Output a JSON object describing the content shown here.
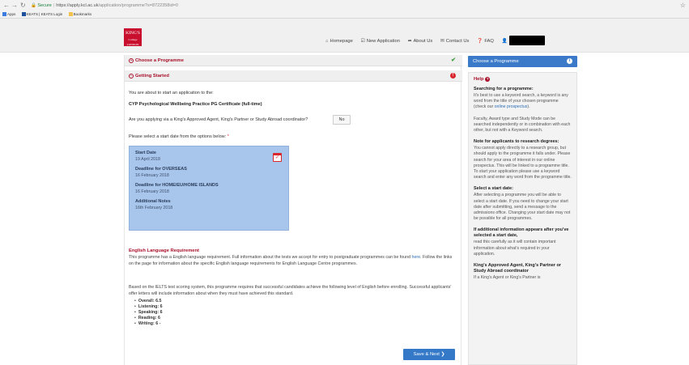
{
  "browser": {
    "secure_label": "Secure",
    "url_host": "https://apply.kcl.ac.uk",
    "url_path": "/application/programme?s=8722358id=0",
    "bookmarks": [
      {
        "label": "Apps",
        "color": "#3d7be0"
      },
      {
        "label": "KEATS | KEATS Login",
        "color": "#1f4e9c"
      },
      {
        "label": "Bookmarks",
        "color": "#f2c14e"
      }
    ]
  },
  "header": {
    "logo_line1": "KING'S",
    "logo_line2": "College LONDON",
    "nav": [
      {
        "icon": "home-icon",
        "glyph": "⌂",
        "label": "Homepage"
      },
      {
        "icon": "new-application-icon",
        "glyph": "☑",
        "label": "New Application"
      },
      {
        "icon": "about-icon",
        "glyph": "➦",
        "label": "About Us"
      },
      {
        "icon": "envelope-icon",
        "glyph": "✉",
        "label": "Contact Us"
      },
      {
        "icon": "question-icon",
        "glyph": "❓",
        "label": "FAQ"
      }
    ]
  },
  "main": {
    "section1": "Choose a Programme",
    "section2": "Getting Started",
    "intro": "You are about to start an application to the:",
    "programme": "CYP Psychological Wellbeing Practice PG Certificate (full-time)",
    "agent_question": "Are you applying via a King's Approved Agent, King's Partner or Study Abroad coordinator?",
    "agent_answer": "No",
    "start_date_prompt": "Please select a start date from the options below:",
    "required_mark": "*",
    "date_card": {
      "start_label": "Start Date",
      "start_value": "19 April 2018",
      "overseas_label": "Deadline for OVERSEAS",
      "overseas_value": "16 February 2018",
      "home_label": "Deadline for HOME/EU/HOME ISLANDS",
      "home_value": "16 February 2018",
      "notes_label": "Additional Notes",
      "notes_value": "16th February 2018"
    },
    "english_title": "English Language Requirement",
    "english_p1_a": "This programme has a English language requirement. Full information about the tests we accept for entry to postgraduate programmes can be found ",
    "english_p1_link": "here",
    "english_p1_b": ". Follow the links on the page for information about the specific English language requirements for English Language Centre programmes.",
    "english_p2": "Based on the IELTS test scoring system, this programme requires that successful candidates achieve the following level of English before enrolling. Successful applicants' offer letters will include information about when they must have achieved this standard.",
    "scores": [
      {
        "label": "Overall:",
        "value": "6.5"
      },
      {
        "label": "Listening:",
        "value": "6"
      },
      {
        "label": "Speaking:",
        "value": "6"
      },
      {
        "label": "Reading:",
        "value": "6"
      },
      {
        "label": "Writing:",
        "value": "6 -"
      }
    ],
    "save_next": "Save & Next"
  },
  "sidebar": {
    "tab": "Choose a Programme",
    "help_title": "Help",
    "sections": [
      {
        "title": "Searching for a programme:",
        "text": "It's best to use a keyword search, a keyword is any word from the title of your chosen programme (check our ",
        "link": "online prospectus",
        "text_after": ")."
      },
      {
        "title": "",
        "text": "Faculty, Award type and Study Mode can be searched independently or in combination with each other, but not with a Keyword search.",
        "link": "",
        "text_after": ""
      },
      {
        "title": "Note for applicants to research degrees:",
        "text": "You cannot apply directly to a research group, but should apply to the programme it falls under. Please search for your area of interest in our online prospectus. This will be linked to a programme title. To start your application please use a keyword search and enter any word from the programme title.",
        "link": "",
        "text_after": ""
      },
      {
        "title": "Select a start date:",
        "text": "After selecting a programme you will be able to select a start date. If you need to change your start date after submitting, send a message to the admissions office. Changing your start date may not be possible for all programmes.",
        "link": "",
        "text_after": ""
      },
      {
        "title": "If additional information appears after you've selected a start date,",
        "text": "read this carefully as it will contain important information about what's required in your application.",
        "link": "",
        "text_after": ""
      },
      {
        "title": "King's Approved Agent, King's Partner or Study Abroad coordinator",
        "text": "If a King's Agent or King's Partner is",
        "link": "",
        "text_after": ""
      }
    ]
  },
  "colors": {
    "brand_red": "#c8102e",
    "accent_blue": "#3a7ac9",
    "date_card_blue": "#a8c6ec"
  }
}
